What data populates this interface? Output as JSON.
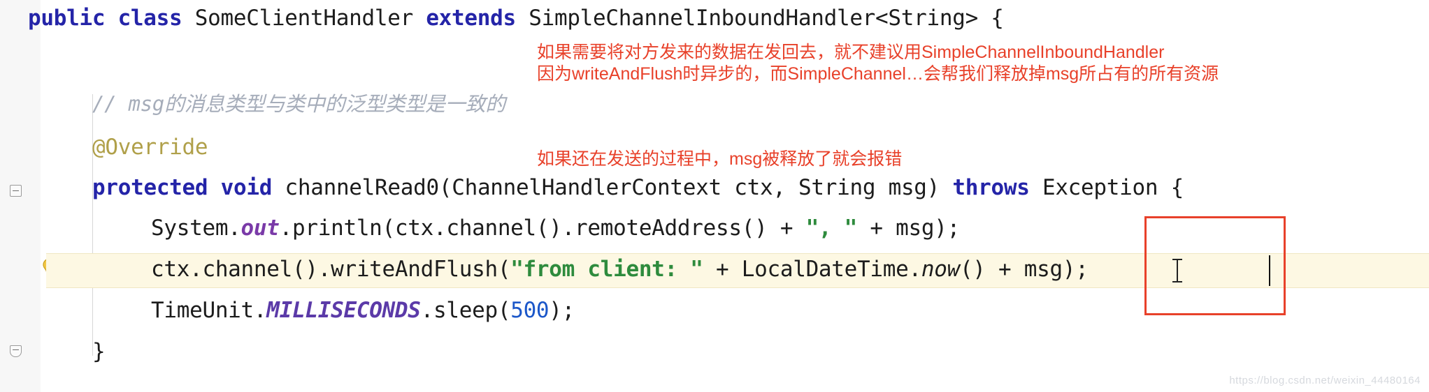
{
  "editor": {
    "language": "java",
    "colors": {
      "keyword": "#2424a8",
      "string": "#2e8b3d",
      "number": "#1b57c9",
      "annotation": "#b0a04a",
      "comment": "#a6adba",
      "field": "#7a3aa8",
      "static": "#5b3aa8",
      "note_red": "#e8412a",
      "highlight_row": "#fdf8e3",
      "gutter": "#f7f7f7"
    }
  },
  "code_lines": [
    {
      "id": "line-class-decl",
      "tokens": [
        {
          "t": "public",
          "c": "kw"
        },
        {
          "t": " ",
          "c": "plain"
        },
        {
          "t": "class",
          "c": "kw"
        },
        {
          "t": " SomeClientHandler ",
          "c": "plain"
        },
        {
          "t": "extends",
          "c": "kw"
        },
        {
          "t": " SimpleChannelInboundHandler<String> {",
          "c": "plain"
        }
      ]
    },
    {
      "id": "line-comment",
      "tokens": [
        {
          "t": "// msg的消息类型与类中的泛型类型是一致的",
          "c": "cmt"
        }
      ]
    },
    {
      "id": "line-override",
      "tokens": [
        {
          "t": "@Override",
          "c": "anno"
        }
      ]
    },
    {
      "id": "line-method-decl",
      "tokens": [
        {
          "t": "protected",
          "c": "kw"
        },
        {
          "t": " ",
          "c": "plain"
        },
        {
          "t": "void",
          "c": "kw"
        },
        {
          "t": " channelRead0(ChannelHandlerContext ctx, String msg) ",
          "c": "plain"
        },
        {
          "t": "throws",
          "c": "kw"
        },
        {
          "t": " Exception {",
          "c": "plain"
        }
      ]
    },
    {
      "id": "line-println",
      "tokens": [
        {
          "t": "System.",
          "c": "plain"
        },
        {
          "t": "out",
          "c": "fld"
        },
        {
          "t": ".println(ctx.channel().remoteAddress() + ",
          "c": "plain"
        },
        {
          "t": "\", \"",
          "c": "str"
        },
        {
          "t": " + msg);",
          "c": "plain"
        }
      ]
    },
    {
      "id": "line-writeandflush",
      "tokens": [
        {
          "t": "ctx.channel().writeAndFlush(",
          "c": "plain"
        },
        {
          "t": "\"from client: \"",
          "c": "str"
        },
        {
          "t": " + LocalDateTime.",
          "c": "plain"
        },
        {
          "t": "now",
          "c": "ital"
        },
        {
          "t": "() + msg);",
          "c": "plain"
        }
      ]
    },
    {
      "id": "line-sleep",
      "tokens": [
        {
          "t": "TimeUnit.",
          "c": "plain"
        },
        {
          "t": "MILLISECONDS",
          "c": "stat"
        },
        {
          "t": ".sleep(",
          "c": "plain"
        },
        {
          "t": "500",
          "c": "num"
        },
        {
          "t": ");",
          "c": "plain"
        }
      ]
    },
    {
      "id": "line-close-brace",
      "tokens": [
        {
          "t": "}",
          "c": "plain"
        }
      ]
    }
  ],
  "annotations": {
    "note_top_line1": "如果需要将对方发来的数据在发回去，就不建议用SimpleChannelInboundHandler",
    "note_top_line2": "因为writeAndFlush时异步的，而SimpleChannel…会帮我们释放掉msg所占有的所有资源",
    "note_mid_line1": "如果还在发送的过程中，msg被释放了就会报错"
  },
  "gutter": {
    "bulb_icon": "lightbulb-icon",
    "fold_icon_top": "code-fold-minus-icon",
    "fold_icon_bottom": "code-fold-end-icon"
  },
  "watermark": {
    "text": "https://blog.csdn.net/weixin_44480164"
  }
}
